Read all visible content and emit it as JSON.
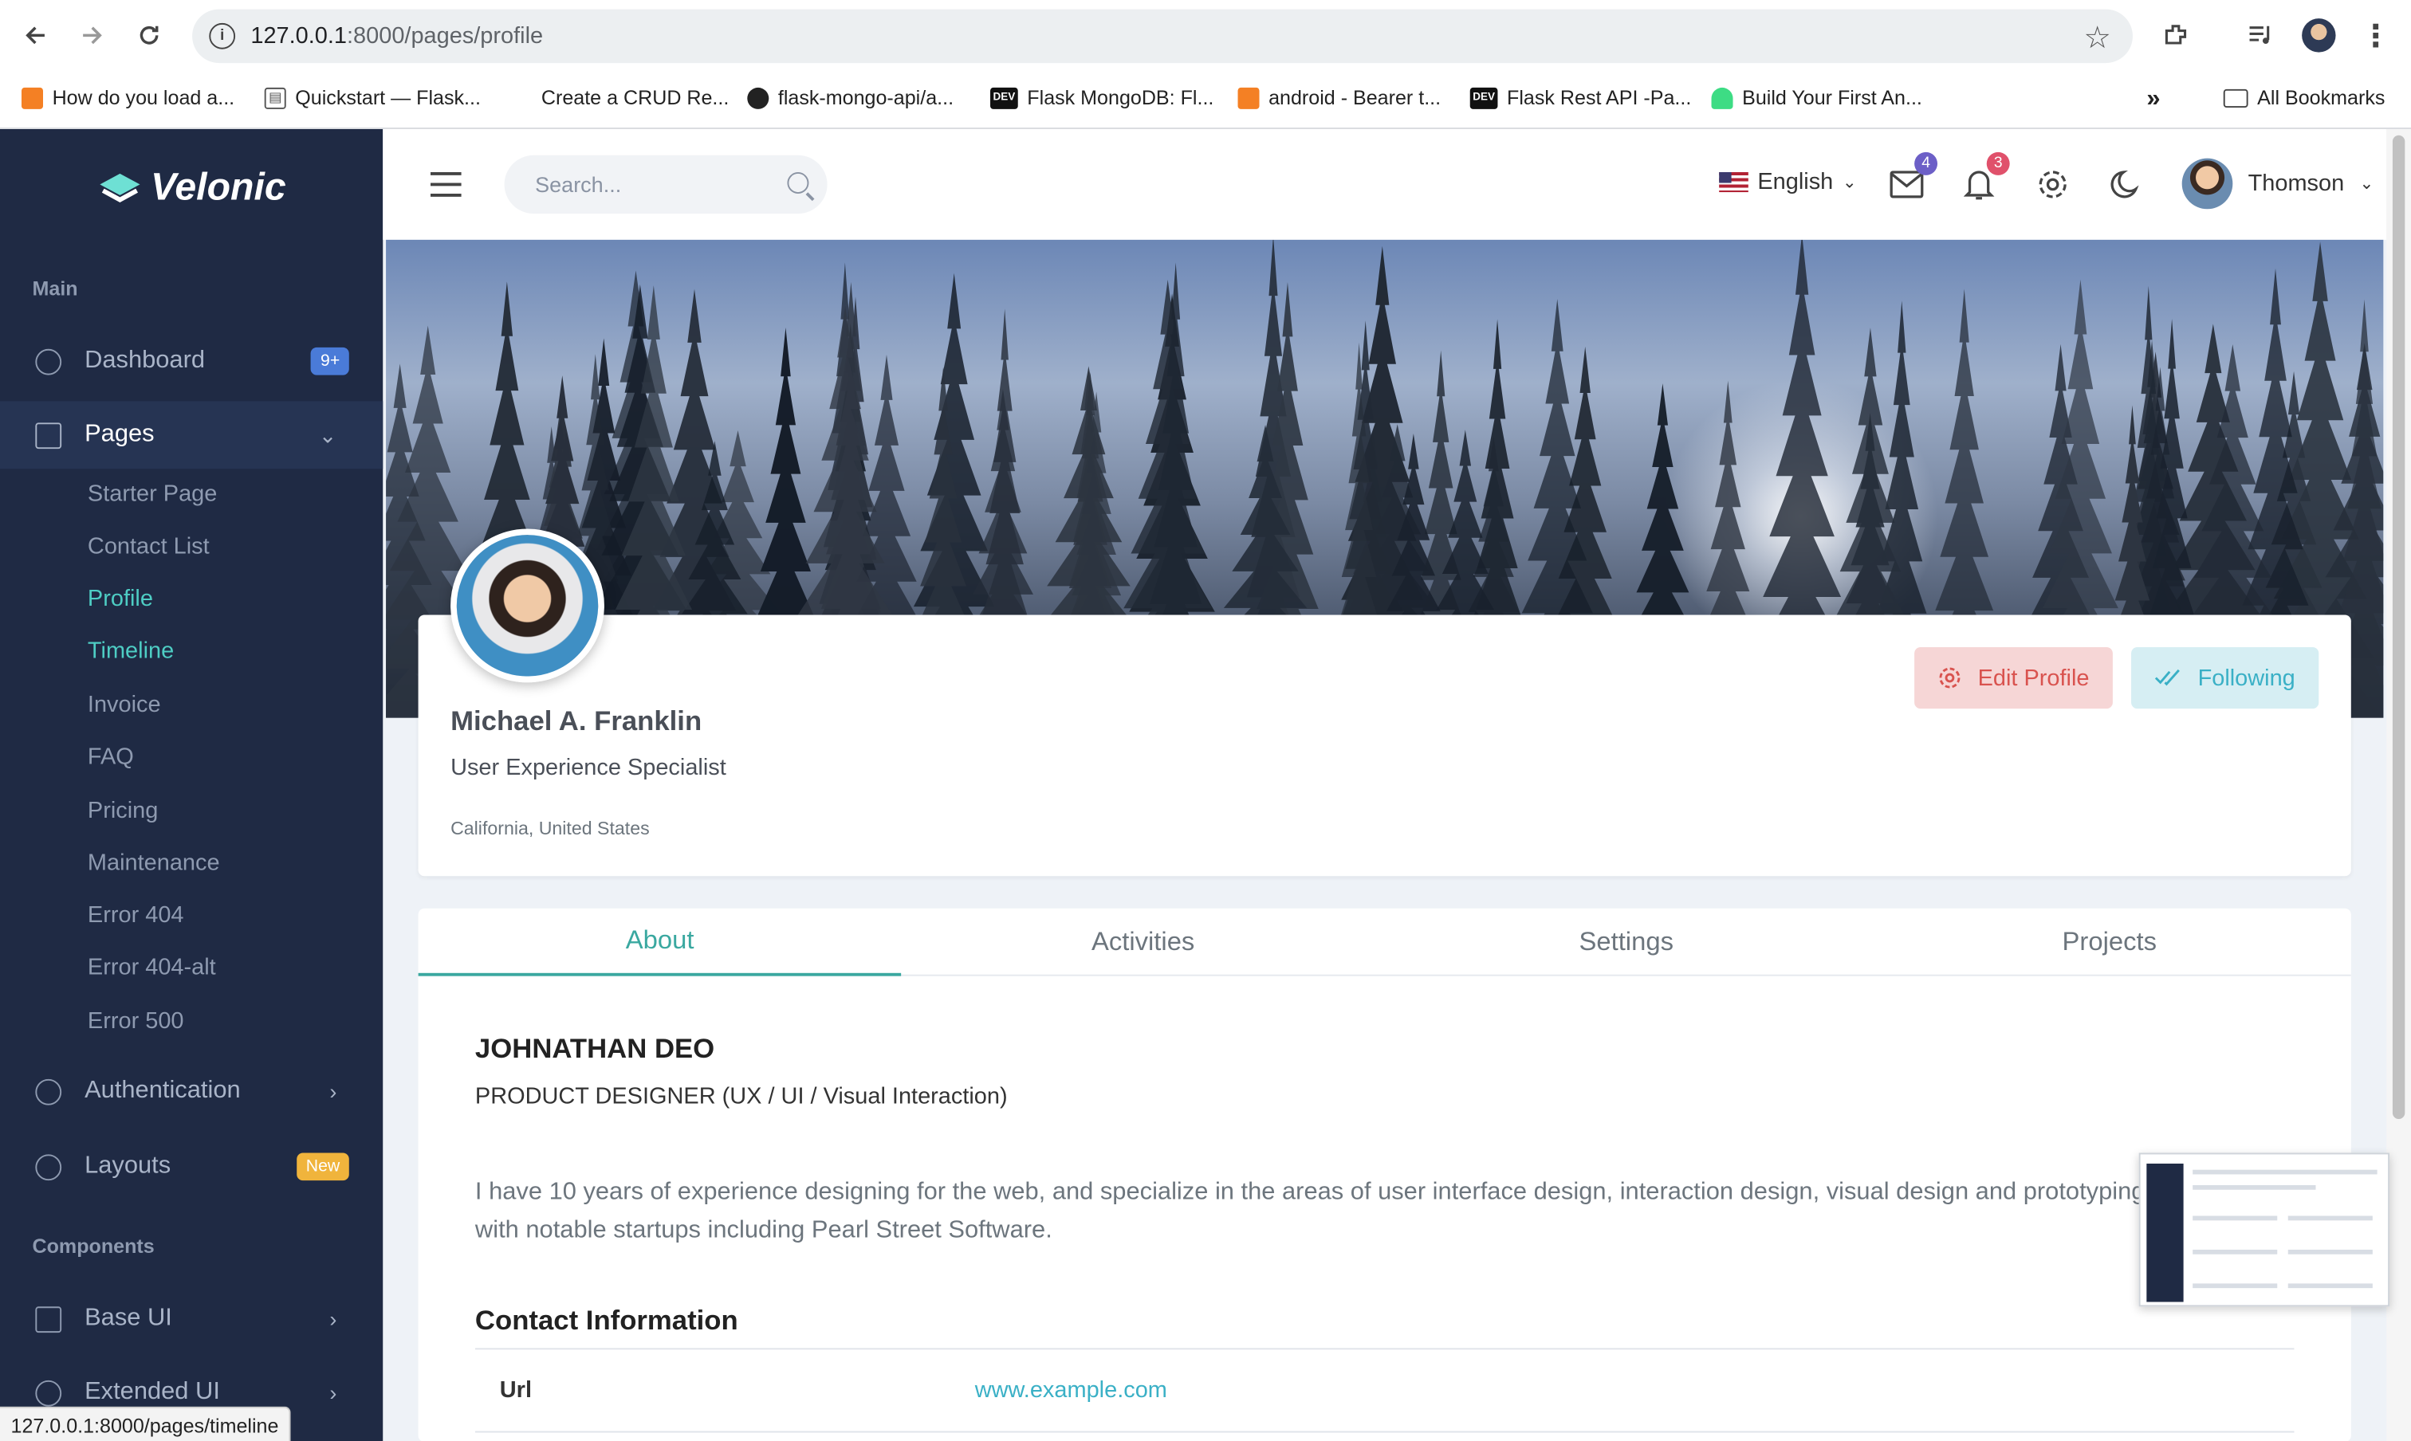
{
  "browser": {
    "url_host": "127.0.0.1",
    "url_path": ":8000/pages/profile",
    "bookmarks": [
      "How do you load a...",
      "Quickstart — Flask...",
      "Create a CRUD Re...",
      "flask-mongo-api/a...",
      "Flask MongoDB: Fl...",
      "android - Bearer t...",
      "Flask Rest API -Pa...",
      "Build Your First An..."
    ],
    "all_bookmarks": "All Bookmarks",
    "bookmarks_more": "»",
    "status_url": "127.0.0.1:8000/pages/timeline"
  },
  "sidebar": {
    "brand": "Velonic",
    "section_main": "Main",
    "dashboard": "Dashboard",
    "dashboard_badge": "9+",
    "pages": "Pages",
    "sub_items": [
      "Starter Page",
      "Contact List",
      "Profile",
      "Timeline",
      "Invoice",
      "FAQ",
      "Pricing",
      "Maintenance",
      "Error 404",
      "Error 404-alt",
      "Error 500"
    ],
    "authentication": "Authentication",
    "layouts": "Layouts",
    "layouts_badge": "New",
    "section_components": "Components",
    "base_ui": "Base UI",
    "extended_ui": "Extended UI"
  },
  "topbar": {
    "search_placeholder": "Search...",
    "language": "English",
    "mail_count": "4",
    "notif_count": "3",
    "username": "Thomson"
  },
  "profile": {
    "name": "Michael A. Franklin",
    "role": "User Experience Specialist",
    "location": "California, United States",
    "edit_button": "Edit Profile",
    "follow_button": "Following"
  },
  "tabs": [
    "About",
    "Activities",
    "Settings",
    "Projects"
  ],
  "about": {
    "name": "JOHNATHAN DEO",
    "title": "PRODUCT DESIGNER (UX / UI / Visual Interaction)",
    "desc_line1": "I have 10 years of experience designing for the web, and specialize in the areas of user interface design, interaction design, visual design and prototyping",
    "desc_line2": "with notable startups including Pearl Street Software.",
    "contact_title": "Contact Information",
    "contact_rows": [
      {
        "key": "Url",
        "value": "www.example.com"
      }
    ]
  },
  "colors": {
    "sidebar_bg": "#1f2a44",
    "accent_teal": "#3aa8a0",
    "badge_blue": "#4a7bd8",
    "badge_new": "#f0b43c",
    "mail_badge": "#6c5fc7",
    "notif_badge": "#e0516b"
  }
}
